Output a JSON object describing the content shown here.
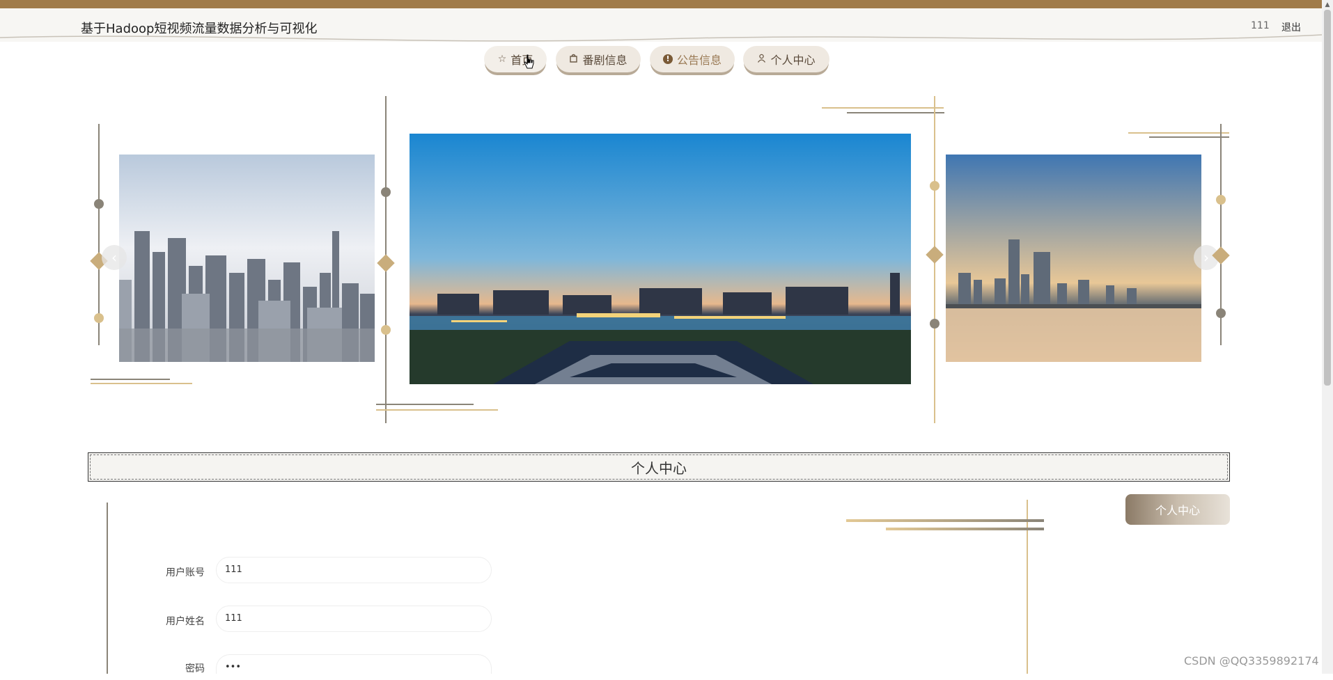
{
  "header": {
    "title": "基于Hadoop短视频流量数据分析与可视化",
    "username": "111",
    "logout_label": "退出"
  },
  "nav": {
    "items": [
      {
        "label": "首页",
        "icon": "star-icon"
      },
      {
        "label": "番剧信息",
        "icon": "bag-icon"
      },
      {
        "label": "公告信息",
        "icon": "notice-icon"
      },
      {
        "label": "个人中心",
        "icon": "user-icon"
      }
    ]
  },
  "carousel": {
    "slides": [
      {
        "name": "city-skyline-cloudy",
        "sky_top": "#c9d6e6",
        "sky_bottom": "#eef0f4"
      },
      {
        "name": "city-night-panorama",
        "sky_top": "#1e8fd6",
        "sky_bottom": "#e8b48a"
      },
      {
        "name": "city-waterfront-sunset",
        "sky_top": "#4a7fb8",
        "sky_bottom": "#e9c89a"
      }
    ],
    "active_index": 0,
    "indicator_count": 3
  },
  "section": {
    "title": "个人中心"
  },
  "profile": {
    "button_label": "个人中心",
    "fields": [
      {
        "label": "用户账号",
        "value": "111"
      },
      {
        "label": "用户姓名",
        "value": "111"
      },
      {
        "label": "密码",
        "value": "•••"
      }
    ]
  },
  "watermark": "CSDN @QQ3359892174",
  "colors": {
    "accent": "#a07b4a",
    "gold": "#d9c08c",
    "gray_line": "#8a8478"
  }
}
